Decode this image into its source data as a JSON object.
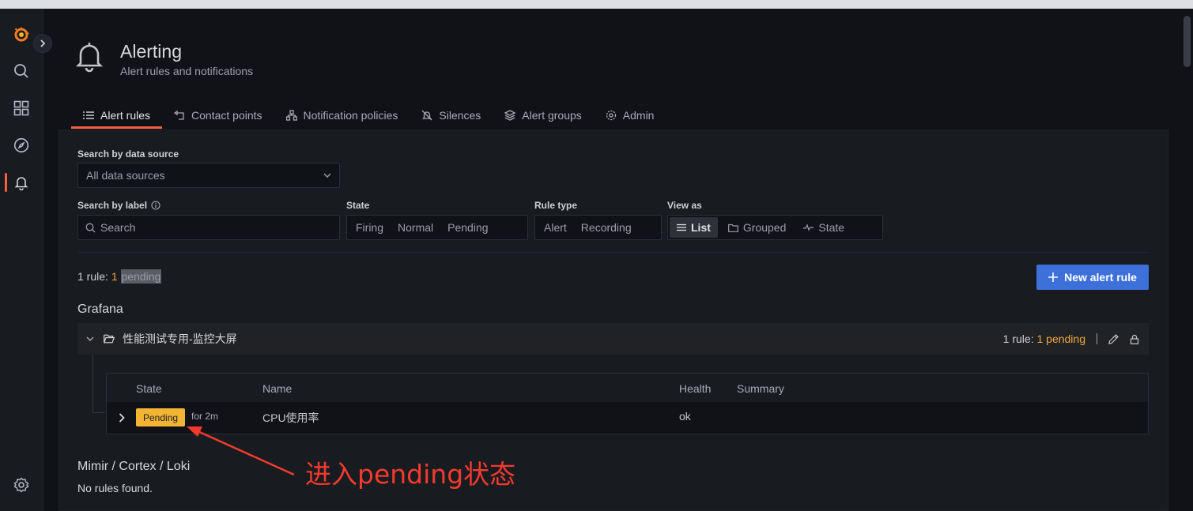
{
  "header": {
    "title": "Alerting",
    "subtitle": "Alert rules and notifications"
  },
  "tabs": [
    {
      "label": "Alert rules",
      "icon": "list-icon",
      "active": true
    },
    {
      "label": "Contact points",
      "icon": "contact-icon",
      "active": false
    },
    {
      "label": "Notification policies",
      "icon": "sitemap-icon",
      "active": false
    },
    {
      "label": "Silences",
      "icon": "bell-slash-icon",
      "active": false
    },
    {
      "label": "Alert groups",
      "icon": "layer-group-icon",
      "active": false
    },
    {
      "label": "Admin",
      "icon": "cog-icon",
      "active": false
    }
  ],
  "filters": {
    "datasource_label": "Search by data source",
    "datasource_value": "All data sources",
    "label_search_label": "Search by label",
    "label_search_placeholder": "Search",
    "state_label": "State",
    "state_options": [
      "Firing",
      "Normal",
      "Pending"
    ],
    "rule_type_label": "Rule type",
    "rule_type_options": [
      "Alert",
      "Recording"
    ],
    "view_as_label": "View as",
    "view_as_options": [
      "List",
      "Grouped",
      "State"
    ],
    "view_as_selected": "List"
  },
  "summary": {
    "prefix": "1 rule: ",
    "count": "1",
    "state_word": "pending"
  },
  "new_rule_button": "New alert rule",
  "sections": {
    "grafana_title": "Grafana",
    "mimir_title": "Mimir / Cortex / Loki",
    "mimir_empty": "No rules found."
  },
  "folder": {
    "name": "性能测试专用-监控大屏",
    "summary_prefix": "1 rule: ",
    "summary_count": "1 pending"
  },
  "table": {
    "columns": [
      "State",
      "Name",
      "Health",
      "Summary"
    ],
    "rows": [
      {
        "state": "Pending",
        "for": "for 2m",
        "name": "CPU使用率",
        "health": "ok",
        "summary": ""
      }
    ]
  },
  "annotation": {
    "text": "进入pending状态"
  },
  "colors": {
    "accent": "#f55f3e",
    "pending": "#f2b433",
    "primary_button": "#3d71d9",
    "annotation": "#f33a2e"
  }
}
